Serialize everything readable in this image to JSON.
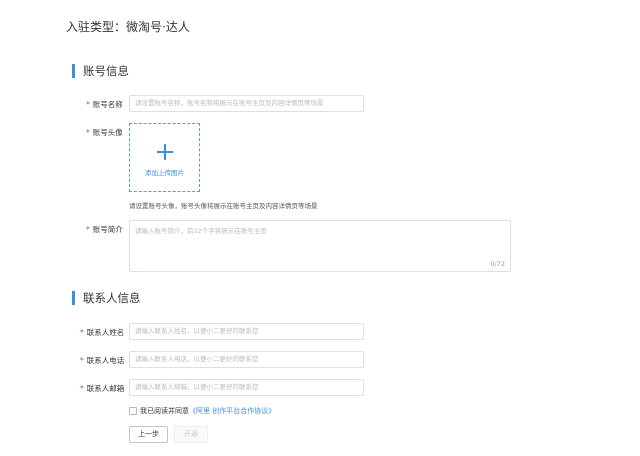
{
  "entry_type": "入驻类型：微淘号·达人",
  "account_section": {
    "title": "账号信息",
    "name_field": {
      "required_mark": "*",
      "label": "账号名称",
      "placeholder": "请设置账号名称，账号名称将展示在账号主页及内容详情页等场景"
    },
    "avatar_field": {
      "required_mark": "*",
      "label": "账号头像",
      "upload_text": "添加上传图片",
      "hint": "请设置账号头像，账号头像将展示在账号主页及内容详情页等场景"
    },
    "intro_field": {
      "required_mark": "*",
      "label": "账号简介",
      "placeholder": "请输入账号简介，前32个字将展示在账号主页",
      "counter": "0/72"
    }
  },
  "contact_section": {
    "title": "联系人信息",
    "name_field": {
      "required_mark": "*",
      "label": "联系人姓名",
      "placeholder": "请输入联系人姓名，以便小二更好的联系您"
    },
    "phone_field": {
      "required_mark": "*",
      "label": "联系人电话",
      "placeholder": "请输入联系人电话，以便小二更好的联系您"
    },
    "email_field": {
      "required_mark": "*",
      "label": "联系人邮箱",
      "placeholder": "请输入联系人邮箱，以便小二更好的联系您"
    }
  },
  "agreement": {
    "checked": false,
    "text": "我已阅读并同意",
    "link": "《阿里 创作平台合作协议》"
  },
  "buttons": {
    "prev": "上一步",
    "submit": "开通"
  },
  "colors": {
    "accent": "#3a8ee6",
    "required": "#e64545",
    "border": "#dcdfe6"
  }
}
